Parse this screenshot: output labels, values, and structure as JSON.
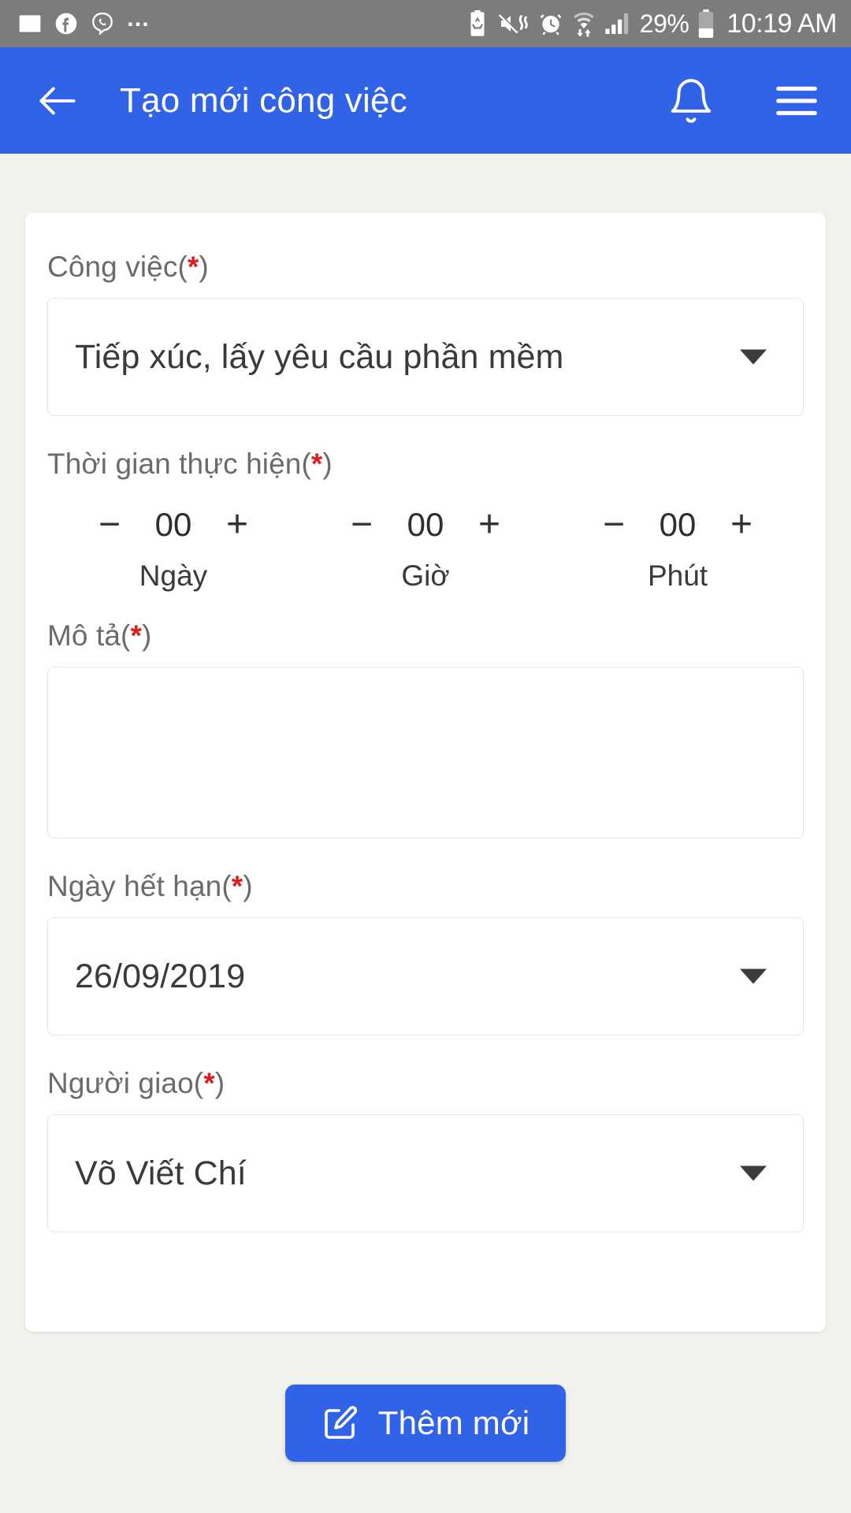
{
  "status_bar": {
    "left_icons": [
      "image-icon",
      "facebook-icon",
      "viber-icon",
      "more-dots-icon"
    ],
    "right_icons": [
      "battery-saver-icon",
      "volume-mute-vibrate-icon",
      "alarm-icon",
      "wifi-data-icon",
      "cellular-signal-icon"
    ],
    "battery_percent": "29%",
    "clock": "10:19 AM"
  },
  "app_bar": {
    "back_icon": "arrow-left-icon",
    "title": "Tạo mới công việc",
    "bell_icon": "bell-icon",
    "menu_icon": "hamburger-menu-icon",
    "background_color": "#3063e8"
  },
  "form": {
    "task": {
      "label": "Công việc",
      "required_mark": "*",
      "value": "Tiếp xúc, lấy yêu cầu phần mềm",
      "caret_icon": "caret-down-icon"
    },
    "duration": {
      "label": "Thời gian thực hiện",
      "required_mark": "*",
      "steppers": [
        {
          "minus": "−",
          "value": "00",
          "plus": "+",
          "unit": "Ngày"
        },
        {
          "minus": "−",
          "value": "00",
          "plus": "+",
          "unit": "Giờ"
        },
        {
          "minus": "−",
          "value": "00",
          "plus": "+",
          "unit": "Phút"
        }
      ]
    },
    "description": {
      "label": "Mô tả",
      "required_mark": "*",
      "value": "",
      "placeholder": ""
    },
    "due_date": {
      "label": "Ngày hết hạn",
      "required_mark": "*",
      "value": "26/09/2019",
      "caret_icon": "caret-down-icon"
    },
    "assigner": {
      "label": "Người giao",
      "required_mark": "*",
      "value": "Võ Viết Chí",
      "caret_icon": "caret-down-icon"
    }
  },
  "footer": {
    "submit_label": "Thêm mới",
    "submit_icon": "edit-square-pencil-icon"
  },
  "colors": {
    "primary": "#3063e8",
    "page_background": "#f2f2ed",
    "card_background": "#ffffff",
    "required_red": "#e01b1b",
    "label_gray": "#6b6b6b",
    "status_bar_gray": "#7c7c7c"
  }
}
